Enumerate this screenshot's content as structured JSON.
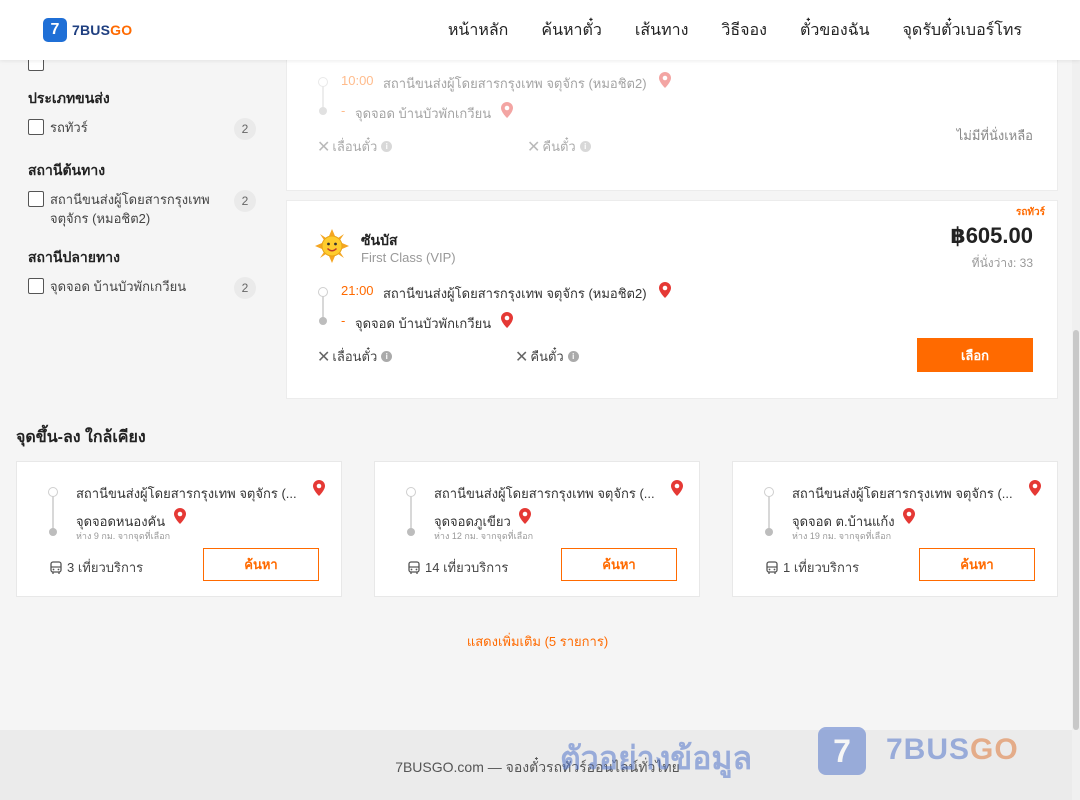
{
  "brand": {
    "logo_mark": "7",
    "name_a": "7BUS",
    "name_b": "GO"
  },
  "nav": [
    "หน้าหลัก",
    "ค้นหาตั๋ว",
    "เส้นทาง",
    "วิธีจอง",
    "ตั๋วของฉัน",
    "จุดรับตั๋วเบอร์โทร"
  ],
  "filters": [
    {
      "title": "ประเภทขนส่ง",
      "label": "รถทัวร์",
      "count": "2"
    },
    {
      "title": "สถานีต้นทาง",
      "label": "สถานีขนส่งผู้โดยสารกรุงเทพ จตุจักร (หมอชิต2)",
      "count": "2"
    },
    {
      "title": "สถานีปลายทาง",
      "label": "จุดจอด บ้านบัวพักเกวียน",
      "count": "2"
    }
  ],
  "trip_faded": {
    "time": "10:00",
    "from": "สถานีขนส่งผู้โดยสารกรุงเทพ จตุจักร (หมอชิต2)",
    "dash": "-",
    "to": "จุดจอด บ้านบัวพักเกวียน",
    "change": "เลื่อนตั๋ว",
    "refund": "คืนตั๋ว",
    "status": "ไม่มีที่นั่งเหลือ"
  },
  "trip": {
    "tag": "รถทัวร์",
    "operator": "ซันบัส",
    "class": "First Class (VIP)",
    "price": "฿605.00",
    "seats": "ที่นั่งว่าง: 33",
    "time": "21:00",
    "from": "สถานีขนส่งผู้โดยสารกรุงเทพ จตุจักร (หมอชิต2)",
    "dash": "-",
    "to": "จุดจอด บ้านบัวพักเกวียน",
    "change": "เลื่อนตั๋ว",
    "refund": "คืนตั๋ว",
    "select": "เลือก"
  },
  "nearby": {
    "title": "จุดขึ้น-ลง ใกล้เคียง",
    "cards": [
      {
        "from": "สถานีขนส่งผู้โดยสารกรุงเทพ จตุจักร (...",
        "to": "จุดจอดหนองคัน",
        "distance": "ห่าง 9 กม. จากจุดที่เลือก",
        "trips": "3 เที่ยวบริการ",
        "button": "ค้นหา"
      },
      {
        "from": "สถานีขนส่งผู้โดยสารกรุงเทพ จตุจักร (...",
        "to": "จุดจอดภูเขียว",
        "distance": "ห่าง 12 กม. จากจุดที่เลือก",
        "trips": "14 เที่ยวบริการ",
        "button": "ค้นหา"
      },
      {
        "from": "สถานีขนส่งผู้โดยสารกรุงเทพ จตุจักร (...",
        "to": "จุดจอด ต.บ้านแก้ง",
        "distance": "ห่าง 19 กม. จากจุดที่เลือก",
        "trips": "1 เที่ยวบริการ",
        "button": "ค้นหา"
      }
    ],
    "show_more": "แสดงเพิ่มเติม (5 รายการ)"
  },
  "footer": {
    "text": "7BUSGO.com — จองตั๋วรถทัวร์ออนไลน์ทั่วไทย"
  },
  "watermark": {
    "text": "ตัวอย่างข้อมูล",
    "mark": "7",
    "brand_a": "7BUS",
    "brand_b": "GO"
  },
  "colors": {
    "accent": "#ff6a00",
    "brand_blue": "#1f6fd6",
    "pin_red": "#e53935"
  }
}
